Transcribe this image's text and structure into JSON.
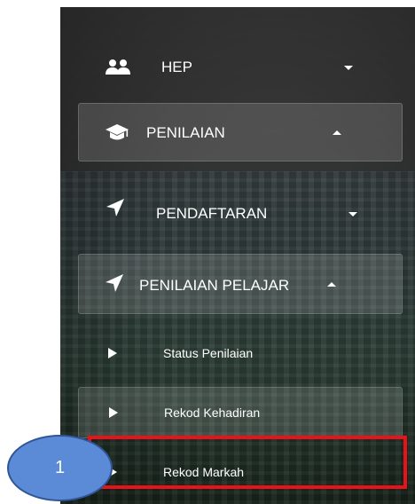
{
  "menu": {
    "hep": {
      "label": "HEP",
      "icon": "users-icon",
      "expanded": false
    },
    "penilaian": {
      "label": "PENILAIAN",
      "icon": "graduation-cap-icon",
      "expanded": true
    },
    "pendaftaran": {
      "label": "PENDAFTARAN",
      "icon": "location-arrow-icon",
      "expanded": false
    },
    "penilaian_pelajar": {
      "label": "PENILAIAN PELAJAR",
      "icon": "location-arrow-icon",
      "expanded": true
    },
    "subitems": [
      {
        "label": "Status Penilaian",
        "icon": "play-icon",
        "active": false
      },
      {
        "label": "Rekod Kehadiran",
        "icon": "play-icon",
        "active": true
      },
      {
        "label": "Rekod Markah",
        "icon": "play-icon",
        "active": false
      }
    ]
  },
  "annotation": {
    "step_number": "1",
    "highlight_color": "#e8121a",
    "badge_color": "#5b8bd6"
  }
}
